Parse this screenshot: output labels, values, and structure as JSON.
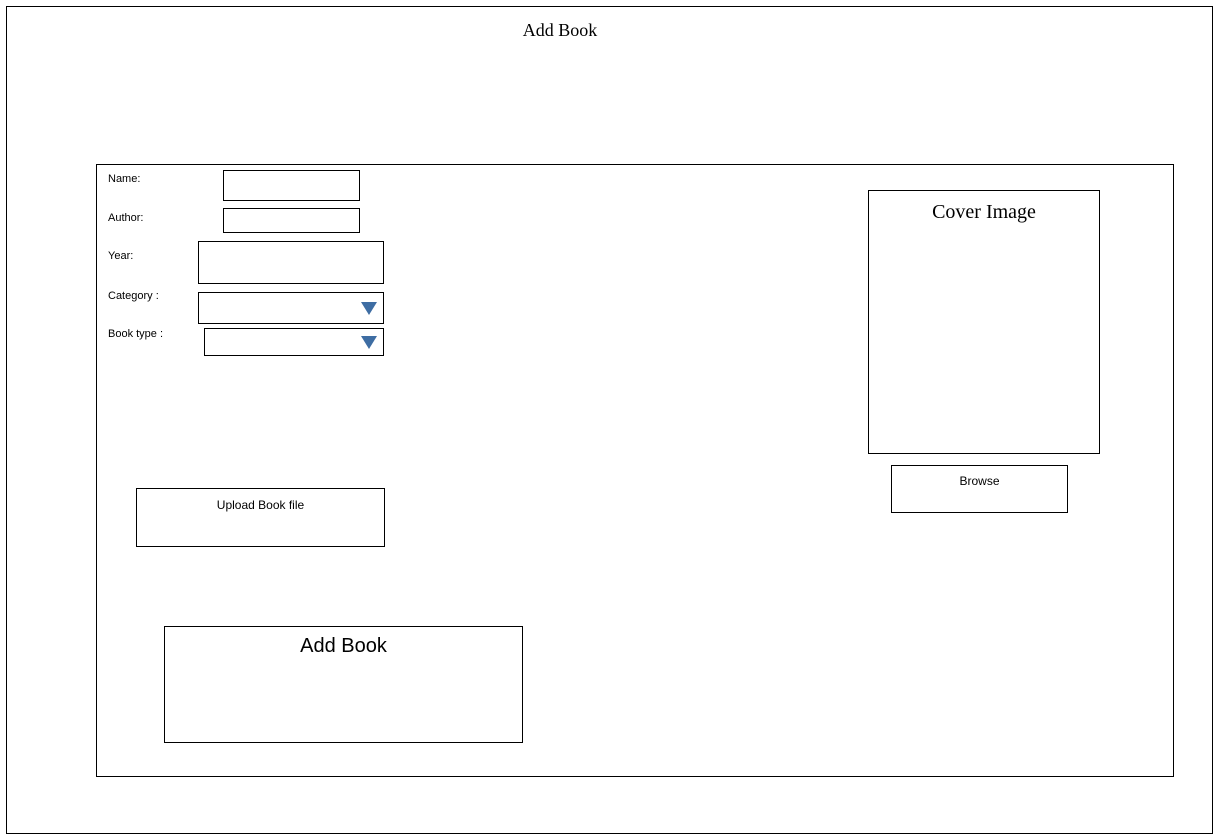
{
  "page": {
    "title": "Add Book"
  },
  "form": {
    "name_label": "Name:",
    "author_label": "Author:",
    "year_label": "Year:",
    "category_label": "Category :",
    "book_type_label": "Book type :",
    "name_value": "",
    "author_value": "",
    "year_value": "",
    "category_value": "",
    "book_type_value": ""
  },
  "icons": {
    "dropdown": "chevron-down-icon",
    "dropdown_color": "#3e6da3"
  },
  "cover": {
    "label": "Cover Image"
  },
  "buttons": {
    "browse": "Browse",
    "upload": "Upload Book file",
    "add": "Add Book"
  }
}
